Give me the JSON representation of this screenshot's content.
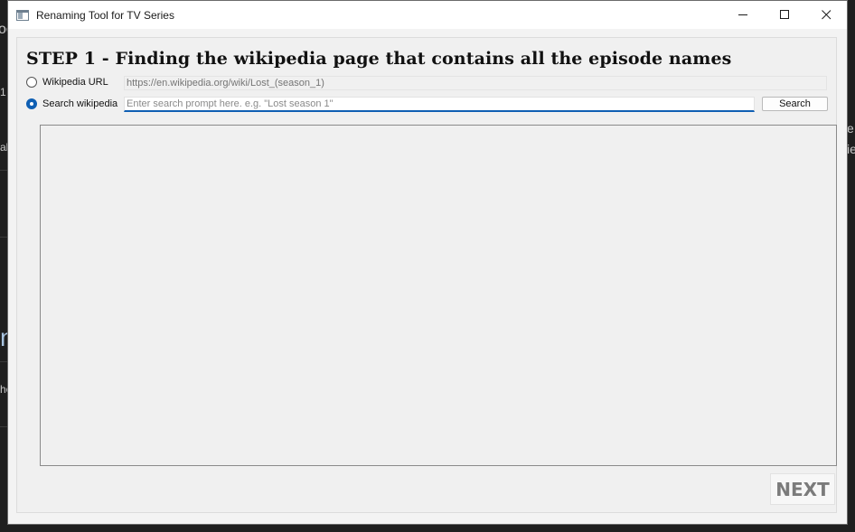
{
  "window": {
    "title": "Renaming Tool for TV Series",
    "controls": [
      "minimize",
      "maximize",
      "close"
    ]
  },
  "step": {
    "heading": "STEP 1 - Finding the wikipedia page that contains all the episode names"
  },
  "options": {
    "url_option": {
      "label": "Wikipedia URL",
      "selected": false
    },
    "search_option": {
      "label": "Search wikipedia",
      "selected": true
    }
  },
  "url_field": {
    "placeholder": "https://en.wikipedia.org/wiki/Lost_(season_1)"
  },
  "search_field": {
    "placeholder": "Enter search prompt here. e.g. \"Lost season 1\"",
    "value": ""
  },
  "buttons": {
    "search_label": "Search",
    "next_label": "NEXT"
  },
  "background_fragments": [
    "oo",
    "1",
    "al",
    "e",
    "ie",
    "n",
    "he"
  ],
  "colors": {
    "accent": "#0f5fb3",
    "window_bg": "#f0f0f0",
    "desktop_bg": "#1f1f1f"
  }
}
